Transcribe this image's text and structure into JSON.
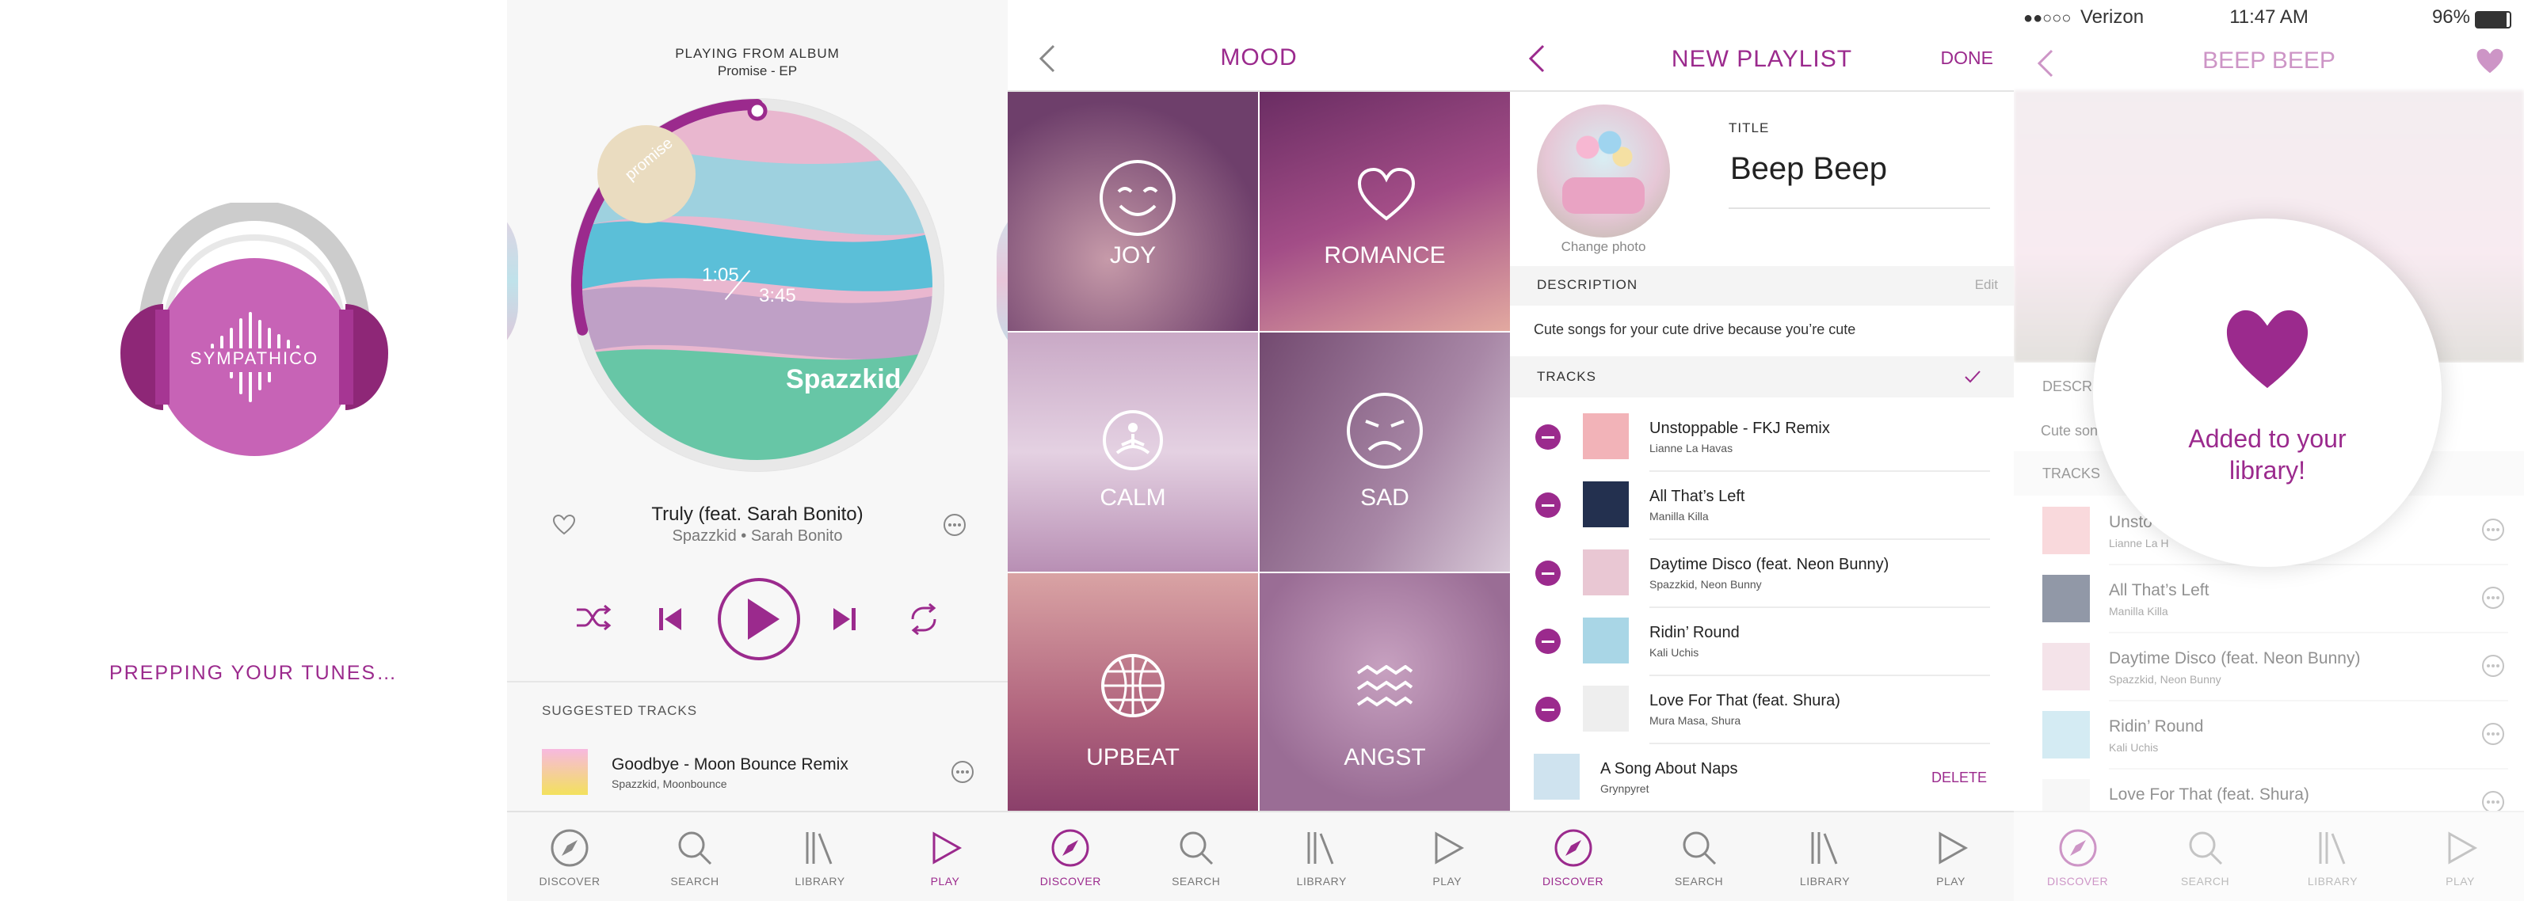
{
  "splash": {
    "brand": "SYMPATHICO",
    "status": "PREPPING YOUR TUNES…",
    "accent": "#9b2a8d"
  },
  "player": {
    "source_label": "PLAYING FROM ALBUM",
    "album": "Promise - EP",
    "elapsed": "1:05",
    "duration": "3:45",
    "progress": 0.29,
    "art_title": "Spazzkid",
    "art_tag": "promise",
    "track_title": "Truly (feat. Sarah Bonito)",
    "track_artist": "Spazzkid • Sarah Bonito",
    "suggested_header": "SUGGESTED TRACKS",
    "suggested": [
      {
        "title": "Goodbye - Moon Bounce Remix",
        "artist": "Spazzkid, Moonbounce"
      }
    ],
    "icons": [
      "heart-icon",
      "more-icon",
      "shuffle-icon",
      "previous-icon",
      "play-icon",
      "next-icon",
      "repeat-icon"
    ]
  },
  "mood": {
    "title": "MOOD",
    "tiles": [
      {
        "label": "JOY",
        "icon": "smile-icon",
        "color": "#7c4b7a"
      },
      {
        "label": "ROMANCE",
        "icon": "heart-outline-icon",
        "color": "#8d3e80"
      },
      {
        "label": "CALM",
        "icon": "meditation-icon",
        "color": "#c6a7c3"
      },
      {
        "label": "SAD",
        "icon": "sad-face-icon",
        "color": "#8e5d8a"
      },
      {
        "label": "UPBEAT",
        "icon": "disco-ball-icon",
        "color": "#b56b7d"
      },
      {
        "label": "ANGST",
        "icon": "waves-icon",
        "color": "#b98bb1"
      }
    ]
  },
  "new_playlist": {
    "title": "NEW PLAYLIST",
    "done": "DONE",
    "change_photo": "Change photo",
    "title_label": "TITLE",
    "title_value": "Beep Beep",
    "description_label": "DESCRIPTION",
    "edit": "Edit",
    "description": "Cute songs for your cute drive because you’re cute",
    "tracks_label": "TRACKS",
    "delete": "DELETE",
    "tracks": [
      {
        "title": "Unstoppable - FKJ Remix",
        "artist": "Lianne La Havas",
        "color": "#f2b3b8"
      },
      {
        "title": "All That’s Left",
        "artist": "Manilla Killa",
        "color": "#23304f"
      },
      {
        "title": "Daytime Disco (feat. Neon Bunny)",
        "artist": "Spazzkid, Neon Bunny",
        "color": "#e9c7d3"
      },
      {
        "title": "Ridin’ Round",
        "artist": "Kali Uchis",
        "color": "#a9d6e6"
      },
      {
        "title": "Love For That (feat. Shura)",
        "artist": "Mura Masa, Shura",
        "color": "#eeeeee"
      },
      {
        "title": "A Song About Naps",
        "artist": "Grynpyret",
        "color": "#cfe3ef"
      }
    ]
  },
  "beep": {
    "status_carrier": "Verizon",
    "status_time": "11:47 AM",
    "status_battery": "96%",
    "title": "BEEP BEEP",
    "added": "Added to your library!",
    "desc_label": "DESCR",
    "desc_short": "Cute son",
    "tracks_label": "TRACKS",
    "tracks": [
      {
        "title": "Unsto",
        "artist": "Lianne La H",
        "color": "#f2b3b8"
      },
      {
        "title": "All That’s Left",
        "artist": "Manilla Killa",
        "color": "#23304f"
      },
      {
        "title": "Daytime Disco (feat. Neon Bunny)",
        "artist": "Spazzkid, Neon Bunny",
        "color": "#e9c7d3"
      },
      {
        "title": "Ridin’ Round",
        "artist": "Kali Uchis",
        "color": "#a9d6e6"
      },
      {
        "title": "Love For That (feat. Shura)",
        "artist": "",
        "color": "#eeeeee"
      }
    ]
  },
  "tabs": {
    "discover": "DISCOVER",
    "search": "SEARCH",
    "library": "LIBRARY",
    "play": "PLAY"
  }
}
